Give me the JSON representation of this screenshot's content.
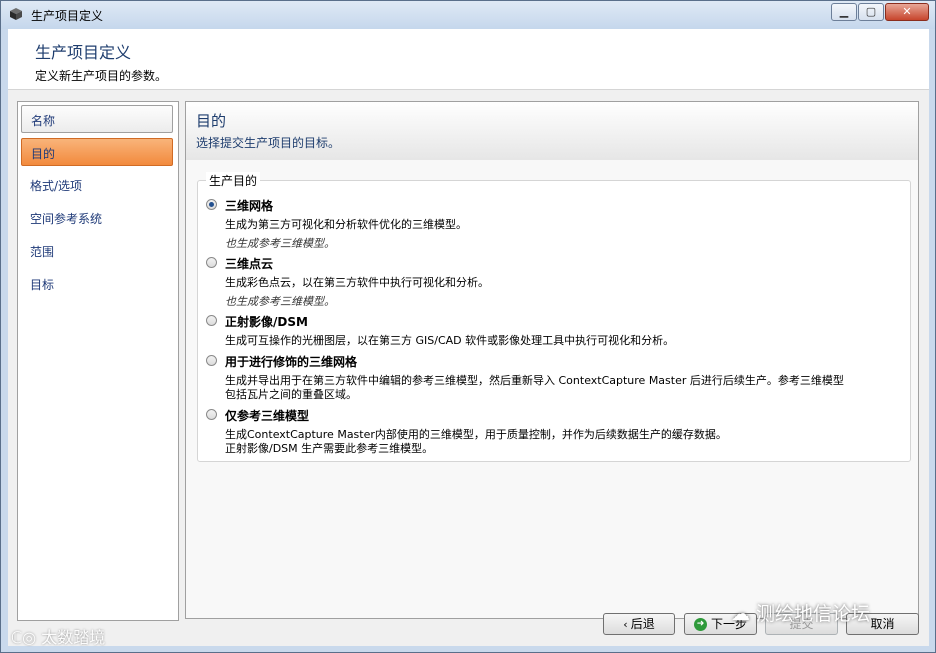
{
  "window": {
    "title": "生产项目定义",
    "controls": {
      "minimize": "▁",
      "maximize": "▢",
      "close": "✕"
    }
  },
  "header": {
    "title": "生产项目定义",
    "subtitle": "定义新生产项目的参数。"
  },
  "sidebar": {
    "items": [
      {
        "label": "名称"
      },
      {
        "label": "目的"
      },
      {
        "label": "格式/选项"
      },
      {
        "label": "空间参考系统"
      },
      {
        "label": "范围"
      },
      {
        "label": "目标"
      }
    ]
  },
  "main": {
    "title": "目的",
    "subtitle": "选择提交生产项目的目标。",
    "group_label": "生产目的",
    "options": [
      {
        "label": "三维网格",
        "desc": "生成为第三方可视化和分析软件优化的三维模型。",
        "note": "也生成参考三维模型。",
        "selected": true
      },
      {
        "label": "三维点云",
        "desc": "生成彩色点云，以在第三方软件中执行可视化和分析。",
        "note": "也生成参考三维模型。",
        "selected": false
      },
      {
        "label": "正射影像/DSM",
        "desc": "生成可互操作的光栅图层，以在第三方 GIS/CAD 软件或影像处理工具中执行可视化和分析。",
        "selected": false
      },
      {
        "label": "用于进行修饰的三维网格",
        "desc": "生成并导出用于在第三方软件中编辑的参考三维模型，然后重新导入 ContextCapture Master 后进行后续生产。参考三维模型",
        "desc2": "包括瓦片之间的重叠区域。",
        "selected": false
      },
      {
        "label": "仅参考三维模型",
        "desc": "生成ContextCapture Master内部使用的三维模型，用于质量控制，并作为后续数据生产的缓存数据。",
        "desc2": "正射影像/DSM 生产需要此参考三维模型。",
        "selected": false
      }
    ]
  },
  "footer": {
    "back_label": "后退",
    "back_icon": "chevron-left-icon",
    "next_label": "下一步",
    "next_icon": "next-arrow-icon",
    "submit_label": "提交",
    "cancel_label": "取消"
  },
  "watermarks": {
    "left": "太数踏境",
    "right": "测绘地信论坛"
  },
  "colors": {
    "active_item": "#f28a3d",
    "title_blue": "#1e3d6e",
    "link_blue": "#1f3a78"
  }
}
